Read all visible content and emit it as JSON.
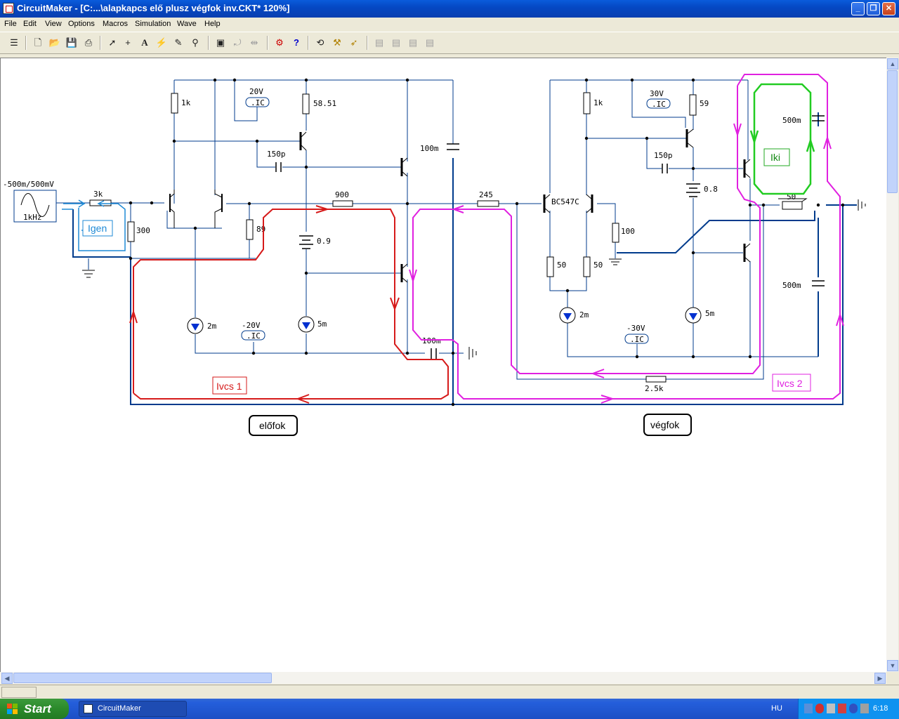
{
  "window": {
    "title": "CircuitMaker - [C:...\\alapkapcs elő plusz végfok inv.CKT* 120%]",
    "minimize": "_",
    "maximize": "❐",
    "close": "✕"
  },
  "menu": [
    "File",
    "Edit",
    "View",
    "Options",
    "Macros",
    "Simulation",
    "Wave",
    "Help"
  ],
  "toolbar": {
    "icons": [
      "component-library-icon",
      "new-file-icon",
      "open-folder-icon",
      "save-disk-icon",
      "print-icon",
      "arrow-select-icon",
      "wire-cross-icon",
      "text-tool-icon",
      "probe-lightning-icon",
      "pen-icon",
      "zoom-icon",
      "zoom-box-icon",
      "rotate-icon",
      "mirror-icon",
      "fault-icon",
      "help-icon",
      "undo-icon",
      "magic-wand-icon",
      "run-icon",
      "disabled-tool-1-icon",
      "disabled-tool-2-icon",
      "disabled-tool-3-icon",
      "disabled-tool-4-icon"
    ]
  },
  "schematic": {
    "source_label": "-500m/500mV",
    "source_freq": "1kHz",
    "labels": {
      "r_3k": "3k",
      "r_300": "300",
      "r_1k_a": "1k",
      "v_20v": "20V",
      "ic_a": ".IC",
      "r_5851": "58.51",
      "c_150p_a": "150p",
      "c_100m_a": "100m",
      "r_900": "900",
      "r_89": "89",
      "batt_09": "0.9",
      "cs_2m_a": "2m",
      "v_n20v": "-20V",
      "ic_b": ".IC",
      "cs_5m_a": "5m",
      "c_100m_b": "100m",
      "r_245": "245",
      "q_bc547c": "BC547C",
      "r_1k_b": "1k",
      "v_30v": "30V",
      "ic_c": ".IC",
      "r_59": "59",
      "c_150p_b": "150p",
      "batt_08": "0.8",
      "r_100": "100",
      "r_50_a": "50",
      "r_50_b": "50",
      "cs_2m_b": "2m",
      "cs_5m_b": "5m",
      "v_n30v": "-30V",
      "ic_d": ".IC",
      "c_500m_a": "500m",
      "c_500m_b": "500m",
      "speaker": "50",
      "r_25k": "2.5k"
    },
    "annotations": {
      "igen": "Igen",
      "lvcs1": "Ivcs 1",
      "lvcs2": "Ivcs 2",
      "lki": "Iki",
      "elofok": "előfok",
      "vegfok": "végfok"
    }
  },
  "taskbar": {
    "start": "Start",
    "task": "CircuitMaker",
    "lang": "HU",
    "clock": "6:18"
  }
}
